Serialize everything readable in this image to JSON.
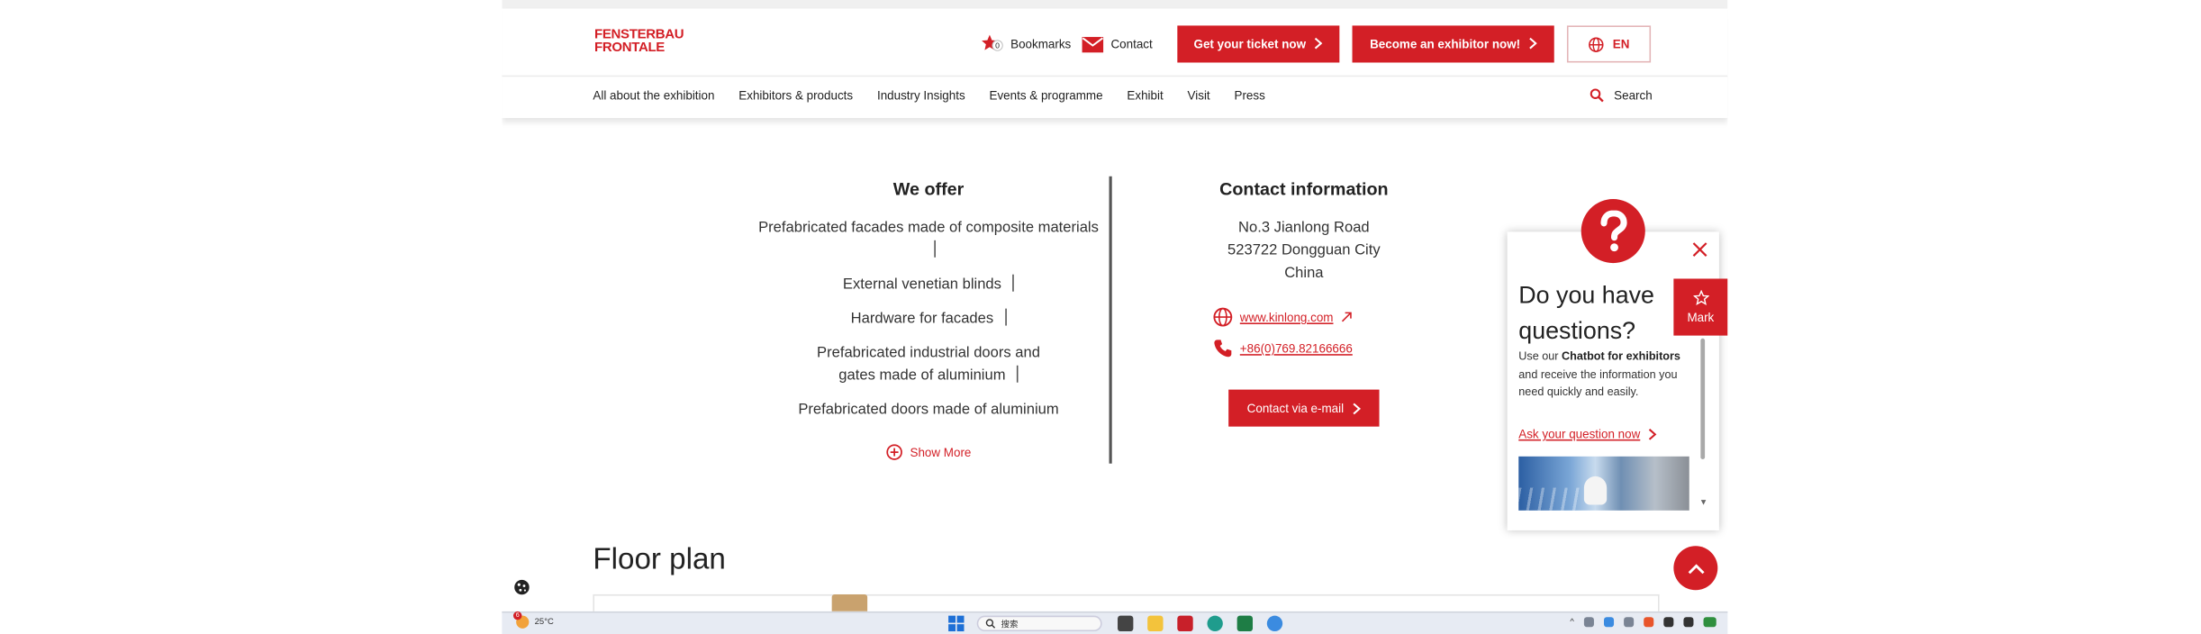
{
  "header": {
    "logo": {
      "line1": "FENSTERBAU",
      "line2": "FRONTALE"
    },
    "bookmarks": {
      "label": "Bookmarks",
      "count": "0"
    },
    "contact_label": "Contact",
    "ticket_button": "Get your ticket now",
    "exhibitor_button": "Become an exhibitor now!",
    "language": "EN"
  },
  "nav": {
    "items": [
      "All about the exhibition",
      "Exhibitors & products",
      "Industry Insights",
      "Events & programme",
      "Exhibit",
      "Visit",
      "Press"
    ],
    "search_label": "Search"
  },
  "offer": {
    "title": "We offer",
    "items": [
      "Prefabricated facades made of composite materials",
      "External venetian blinds",
      "Hardware for facades",
      "Prefabricated industrial doors and gates made of aluminium",
      "Prefabricated doors made of aluminium"
    ],
    "show_more": "Show More"
  },
  "contact": {
    "title": "Contact information",
    "address": [
      "No.3 Jianlong Road",
      "523722 Dongguan City",
      "China"
    ],
    "website": "www.kinlong.com",
    "phone": "+86(0)769.82166666",
    "email_button": "Contact via e-mail"
  },
  "floor": {
    "title": "Floor plan"
  },
  "chatbot": {
    "title": "Do you have questions?",
    "text_pre": "Use our ",
    "text_bold": "Chatbot for exhibitors",
    "text_post": " and receive the information you need quickly and easily.",
    "ask_link": "Ask your question now"
  },
  "mark_label": "Mark",
  "taskbar": {
    "weather_temp": "25°C",
    "weather_badge": "6",
    "search_placeholder": "搜索"
  },
  "colors": {
    "brand_red": "#d31f26",
    "text": "#222222",
    "divider": "#555555"
  }
}
